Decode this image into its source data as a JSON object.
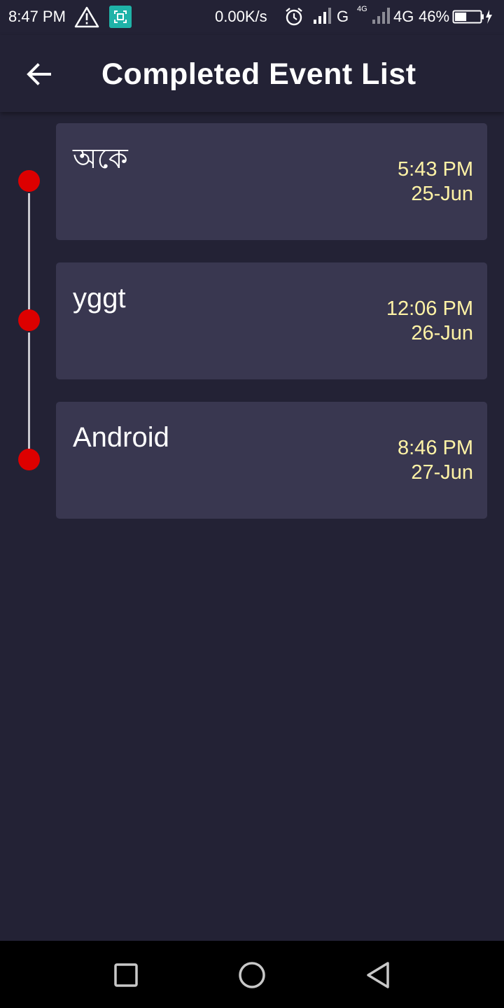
{
  "status_bar": {
    "time": "8:47 PM",
    "net_speed": "0.00K/s",
    "network_type_1": "G",
    "network_small_label": "4G",
    "network_type_2": "4G",
    "battery_percent": "46%",
    "battery_level": 0.46
  },
  "header": {
    "title": "Completed Event List",
    "back_icon": "arrow-left-icon"
  },
  "events": [
    {
      "title": "অকে",
      "time": "5:43 PM",
      "date": "25-Jun"
    },
    {
      "title": "yggt",
      "time": "12:06 PM",
      "date": "26-Jun"
    },
    {
      "title": "Android",
      "time": "8:46 PM",
      "date": "27-Jun"
    }
  ],
  "colors": {
    "background": "#232235",
    "card": "#393750",
    "dot": "#dd0000",
    "time_text": "#fff3a6",
    "line": "#c9c9cf"
  },
  "nav_bar": {
    "icons": [
      "recent-apps-icon",
      "home-icon",
      "back-triangle-icon"
    ]
  }
}
